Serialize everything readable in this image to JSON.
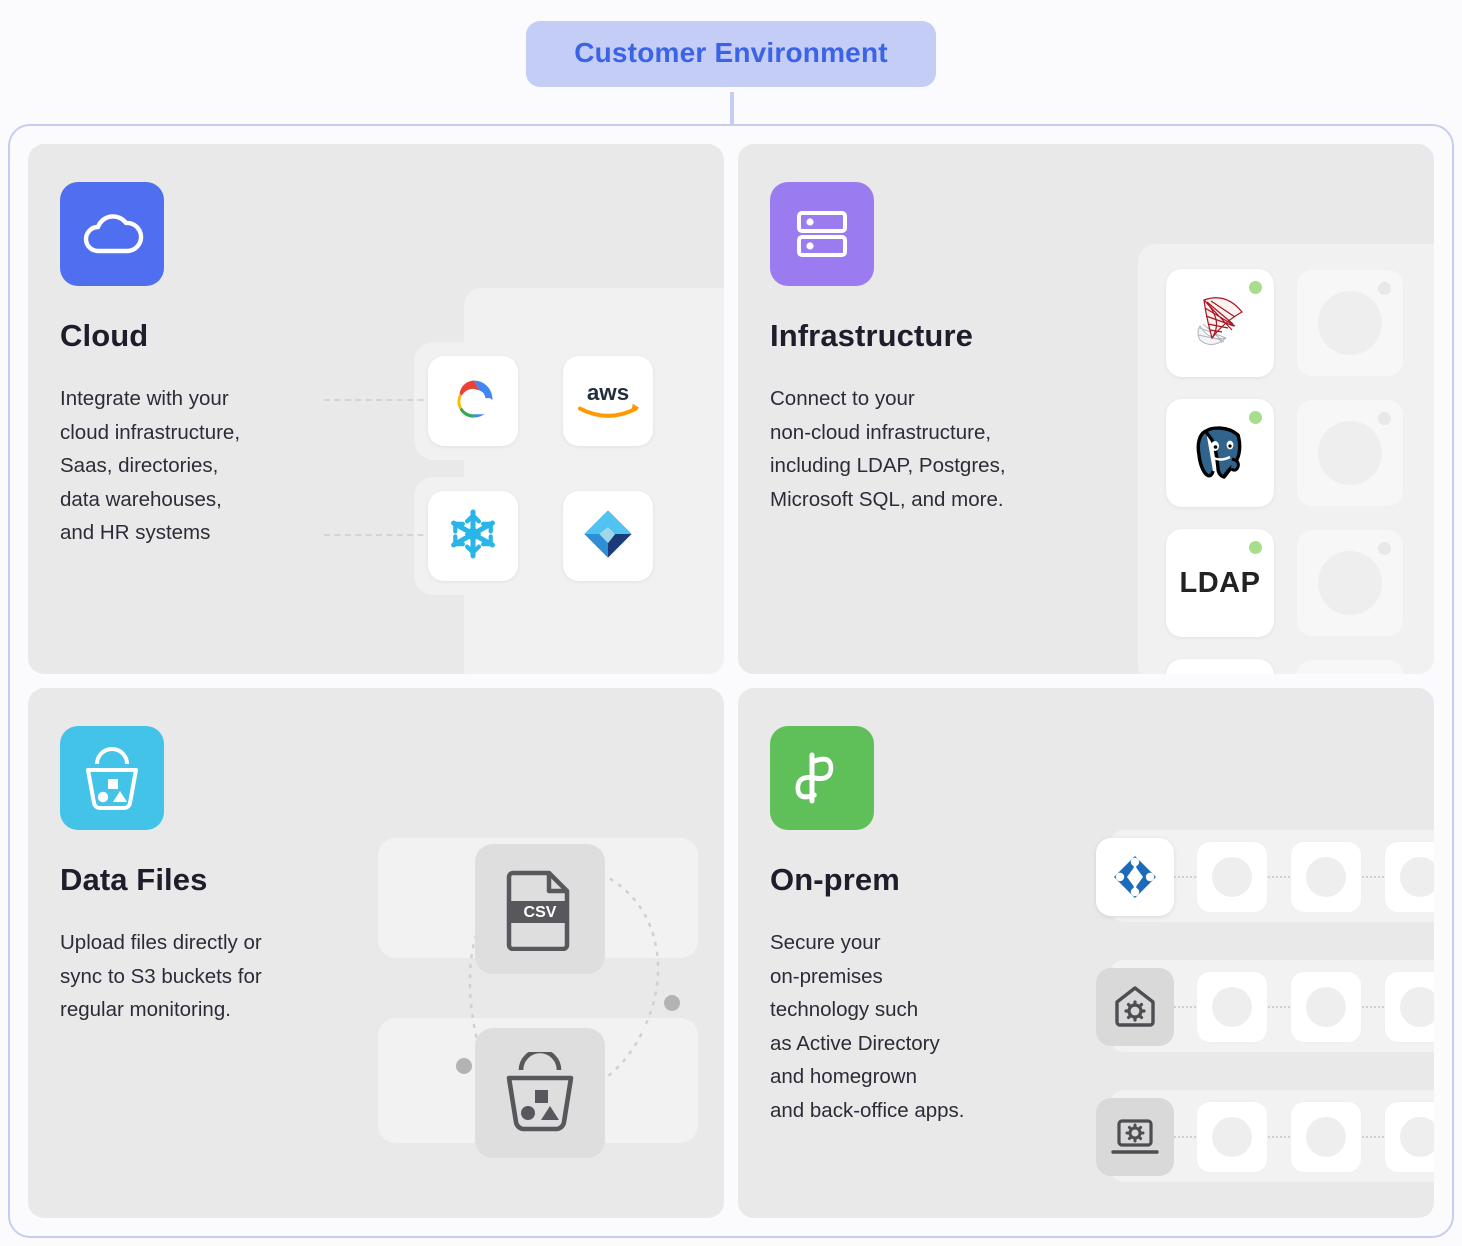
{
  "header": {
    "badge_label": "Customer Environment",
    "badge_bg": "#c3cdf5",
    "badge_text_color": "#3b63e8",
    "container_border_color": "#c5cef0"
  },
  "cards": [
    {
      "id": "cloud",
      "icon_name": "cloud-icon",
      "icon_bg": "#4f6ef0",
      "title": "Cloud",
      "description": "Integrate with your\ncloud infrastructure,\nSaas, directories,\ndata warehouses,\nand HR systems",
      "logos": [
        {
          "name": "google-cloud-logo",
          "label": "Google Cloud"
        },
        {
          "name": "aws-logo",
          "label": "aws"
        },
        {
          "name": "snowflake-logo",
          "label": "Snowflake"
        },
        {
          "name": "azure-ad-logo",
          "label": "Azure Active Directory"
        }
      ]
    },
    {
      "id": "infrastructure",
      "icon_name": "server-rack-icon",
      "icon_bg": "#9b7bf0",
      "title": "Infrastructure",
      "description": "Connect to your\nnon-cloud infrastructure,\nincluding LDAP, Postgres,\nMicrosoft SQL, and more.",
      "status_dot_color": "#a8dd8c",
      "logos": [
        {
          "name": "microsoft-sql-server-logo",
          "label": "Microsoft SQL Server",
          "status": "online"
        },
        {
          "name": "postgresql-logo",
          "label": "PostgreSQL",
          "status": "online"
        },
        {
          "name": "ldap-logo",
          "label": "LDAP",
          "status": "online"
        }
      ],
      "placeholder_count": 4
    },
    {
      "id": "data-files",
      "icon_name": "bucket-icon",
      "icon_bg": "#44c3e8",
      "title": "Data Files",
      "description": "Upload files directly or\nsync to S3 buckets for\nregular monitoring.",
      "graphics": [
        {
          "name": "csv-file-icon",
          "label": "CSV"
        },
        {
          "name": "bucket-icon",
          "label": "Bucket"
        }
      ]
    },
    {
      "id": "on-prem",
      "icon_name": "braid-knot-icon",
      "icon_bg": "#5fc05a",
      "title": "On-prem",
      "description": "Secure your\non-premises\ntechnology such\nas Active Directory\nand homegrown\nand back-office apps.",
      "rows": [
        {
          "name": "active-directory-logo",
          "label": "Active Directory"
        },
        {
          "name": "house-gear-icon",
          "label": "Homegrown app"
        },
        {
          "name": "laptop-gear-icon",
          "label": "Back-office app"
        }
      ],
      "placeholders_per_row": 4
    }
  ]
}
